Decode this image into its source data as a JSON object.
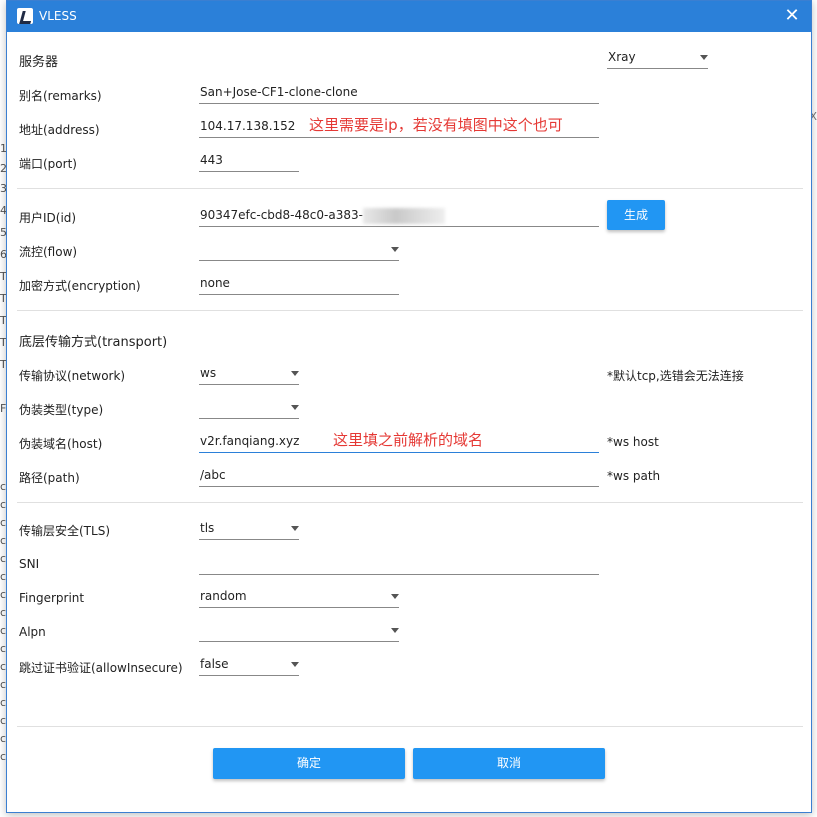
{
  "window": {
    "title": "VLESS",
    "accent": "#2b80d9"
  },
  "server": {
    "section_label": "服务器",
    "core_type": "Xray",
    "remarks_label": "别名(remarks)",
    "remarks_value": "San+Jose-CF1-clone-clone",
    "address_label": "地址(address)",
    "address_value": "104.17.138.152",
    "port_label": "端口(port)",
    "port_value": "443"
  },
  "user": {
    "id_label": "用户ID(id)",
    "id_value": "90347efc-cbd8-48c0-a383-",
    "generate_button": "生成",
    "flow_label": "流控(flow)",
    "flow_value": "",
    "encryption_label": "加密方式(encryption)",
    "encryption_value": "none"
  },
  "transport": {
    "section_label": "底层传输方式(transport)",
    "network_label": "传输协议(network)",
    "network_value": "ws",
    "network_hint": "*默认tcp,选错会无法连接",
    "type_label": "伪装类型(type)",
    "type_value": "",
    "host_label": "伪装域名(host)",
    "host_value": "v2r.fanqiang.xyz",
    "host_hint": "*ws host",
    "path_label": "路径(path)",
    "path_value": "/abc",
    "path_hint": "*ws path"
  },
  "tls": {
    "security_label": "传输层安全(TLS)",
    "security_value": "tls",
    "sni_label": "SNI",
    "sni_value": "",
    "fingerprint_label": "Fingerprint",
    "fingerprint_value": "random",
    "alpn_label": "Alpn",
    "alpn_value": "",
    "insecure_label": "跳过证书验证(allowInsecure)",
    "insecure_value": "false"
  },
  "annotations": {
    "address_note": "这里需要是ip，若没有填图中这个也可",
    "host_note": "这里填之前解析的域名"
  },
  "footer": {
    "ok_button": "确定",
    "cancel_button": "取消"
  },
  "background": {
    "left_chars": [
      "1",
      "2",
      "3",
      "4",
      "5",
      "6",
      "T",
      "T",
      "T",
      "T",
      "T",
      "F",
      "c",
      "c",
      "c",
      "c",
      "c",
      "c",
      "c",
      "c",
      "c",
      "c",
      "c",
      "c",
      "c",
      "c",
      "c",
      "c",
      "c",
      "c",
      "c",
      "c"
    ],
    "right_chars": [
      "X"
    ]
  }
}
